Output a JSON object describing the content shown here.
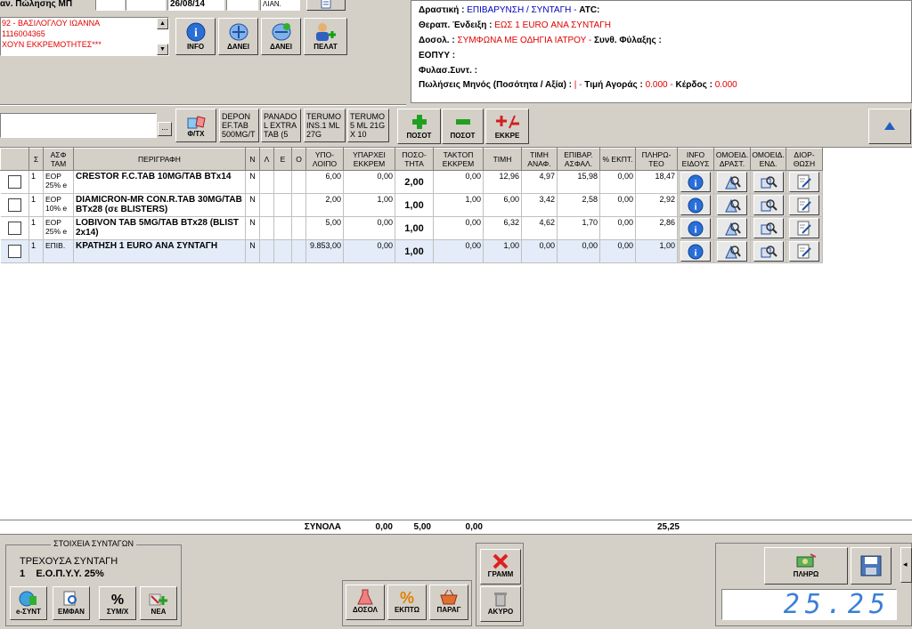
{
  "header": {
    "pos_label": "αν. Πώλησης ΜΠ",
    "date": "26/08/14",
    "price_type": "ΛΙΑΝ.",
    "patient_lines": [
      "92 - ΒΑΣΙΛΟΓΛΟΥ ΙΩΑΝΝΑ",
      "1116004365",
      "ΧΟΥΝ ΕΚΚΡΕΜΟΤΗΤΕΣ***"
    ],
    "buttons": [
      {
        "label": "INFO",
        "icon": "info-icon"
      },
      {
        "label": "ΔΑΝΕΙ",
        "icon": "lend-icon"
      },
      {
        "label": "ΔΑΝΕΙ",
        "icon": "lend-alt-icon"
      },
      {
        "label": "ΠΕΛΑΤ",
        "icon": "customer-add-icon"
      }
    ]
  },
  "info": {
    "drastiki_label": "Δραστική :",
    "drastiki_value": "ΕΠΙΒΑΡΥΝΣΗ / ΣΥΝΤΑΓΗ -",
    "atc_label": "ATC:",
    "endeixi_label": "Θεραπ. Ένδειξη :",
    "endeixi_value": "ΕΩΣ 1 EURO ΑΝΑ ΣΥΝΤΑΓΗ",
    "dosol_label": "Δοσολ. :",
    "dosol_value": "ΣΥΜΦΩΝΑ ΜΕ ΟΔΗΓΙΑ ΙΑΤΡΟΥ -",
    "fylaxi_label": "Συνθ. Φύλαξης :",
    "eopyy_label": "ΕΟΠΥΥ :",
    "fylas_label": "Φυλασ.Συντ. :",
    "sales_label": "Πωλήσεις Μηνός (Ποσότητα / Αξία) :",
    "sales_value": "| -",
    "tim_label": "Τιμή Αγοράς :",
    "tim_value": "0.000 -",
    "kerdos_label": "Κέρδος :",
    "kerdos_value": "0.000"
  },
  "toolbar": {
    "search_more": "...",
    "ftx_label": "Φ/ΤΧ",
    "quick_items": [
      "DEPON EF.TAB 500MG/T",
      "PANADO L EXTRA TAB (5",
      "TERUMO INS.1 ML 27G",
      "TERUMO 5 ML 21G X 10"
    ],
    "plus_label": "ΠΟΣΟΤ",
    "minus_label": "ΠΟΣΟΤ",
    "ekkre_label": "ΕΚΚΡΕ"
  },
  "grid": {
    "columns": [
      "",
      "Σ",
      "ΑΣΦ ΤΑΜ",
      "ΠΕΡΙΓΡΑΦΗ",
      "Ν",
      "Λ",
      "Ε",
      "Ο",
      "ΥΠΟ- ΛΟΙΠΟ",
      "ΥΠΑΡΧΕΙ ΕΚΚΡΕΜ",
      "ΠΟΣΟ- ΤΗΤΑ",
      "ΤΑΚΤΟΠ ΕΚΚΡΕΜ",
      "ΤΙΜΗ",
      "ΤΙΜΗ ΑΝΑΦ.",
      "ΕΠΙΒΑΡ. ΑΣΦΑΛ.",
      "% ΕΚΠΤ.",
      "ΠΛΗΡΩ- ΤΕΟ",
      "INFO ΕΙΔΟΥΣ",
      "ΟΜΟΕΙΔ. ΔΡΑΣΤ.",
      "ΟΜΟΕΙΔ. ΕΝΔ.",
      "ΔΙΟΡ- ΘΩΣΗ"
    ],
    "rows": [
      {
        "s": "1",
        "asf": "EOP 25% e",
        "desc": "CRESTOR F.C.TAB 10MG/TAB BTx14",
        "n": "N",
        "ypol": "6,00",
        "yparxei": "0,00",
        "posot": "2,00",
        "taktop": "0,00",
        "timi": "12,96",
        "timianaf": "4,97",
        "epibar": "15,98",
        "ekpt": "0,00",
        "plir": "18,47"
      },
      {
        "s": "1",
        "asf": "EOP 10% e",
        "desc": "DIAMICRON-MR CON.R.TAB 30MG/TAB BTx28 (σε BLISTERS)",
        "n": "N",
        "ypol": "2,00",
        "yparxei": "1,00",
        "posot": "1,00",
        "taktop": "1,00",
        "timi": "6,00",
        "timianaf": "3,42",
        "epibar": "2,58",
        "ekpt": "0,00",
        "plir": "2,92"
      },
      {
        "s": "1",
        "asf": "EOP 25% e",
        "desc": "LOBIVON TAB 5MG/TAB BTx28 (BLIST 2x14)",
        "n": "N",
        "ypol": "5,00",
        "yparxei": "0,00",
        "posot": "1,00",
        "taktop": "0,00",
        "timi": "6,32",
        "timianaf": "4,62",
        "epibar": "1,70",
        "ekpt": "0,00",
        "plir": "2,86"
      },
      {
        "s": "1",
        "asf": "ΕΠΙΒ.",
        "desc": "ΚΡΑΤΗΣΗ 1 EURO ΑΝΑ ΣΥΝΤΑΓΗ",
        "n": "N",
        "ypol": "9.853,00",
        "yparxei": "0,00",
        "posot": "1,00",
        "taktop": "0,00",
        "timi": "1,00",
        "timianaf": "0,00",
        "epibar": "0,00",
        "ekpt": "0,00",
        "plir": "1,00"
      }
    ]
  },
  "totals": {
    "label": "ΣΥΝΟΛΑ",
    "yparxei": "0,00",
    "posot": "5,00",
    "taktop": "0,00",
    "plir": "25,25"
  },
  "prescription": {
    "group_title": "ΣΤΟΙΧΕΙΑ ΣΥΝΤΑΓΩΝ",
    "current_label": "ΤΡΕΧΟΥΣΑ ΣΥΝΤΑΓΗ",
    "current_value": "1    Ε.Ο.Π.Υ.Υ. 25%",
    "buttons": [
      "e-ΣΥΝΤ",
      "ΕΜΦΑΝ",
      "ΣΥΜ/Χ",
      "ΝΕΑ"
    ]
  },
  "bottom": {
    "gramm_label": "ΓΡΑΜΜ",
    "akyro_label": "ΑΚΥΡΟ",
    "dosol_label": "ΔΟΣΟΛ",
    "ekpto_label": "ΕΚΠΤΩ",
    "parag_label": "ΠΑΡΑΓ",
    "pliro_label": "ΠΛΗΡΩ",
    "display_total": "25.25"
  }
}
